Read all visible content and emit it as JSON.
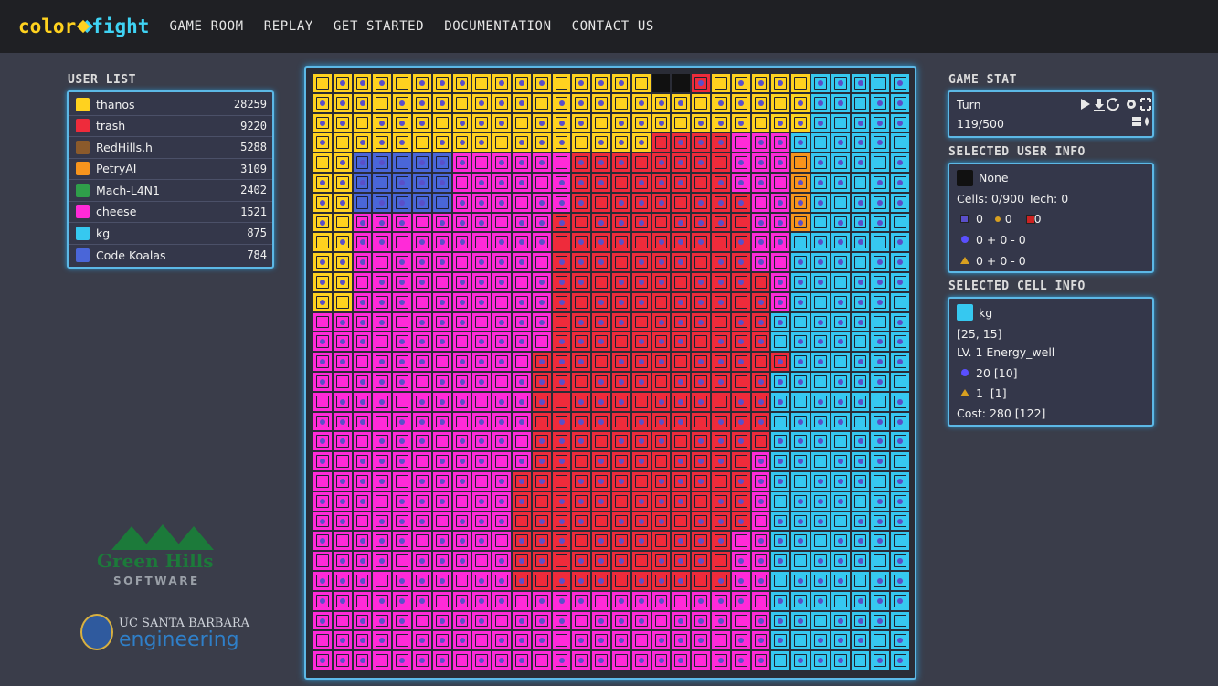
{
  "nav": {
    "logo_part1": "color",
    "logo_part2": "fight",
    "items": [
      "GAME ROOM",
      "REPLAY",
      "GET STARTED",
      "DOCUMENTATION",
      "CONTACT US"
    ]
  },
  "user_list": {
    "title": "USER LIST",
    "users": [
      {
        "name": "thanos",
        "score": "28259",
        "color": "#ffd21f"
      },
      {
        "name": "trash",
        "score": "9220",
        "color": "#ee2b3b"
      },
      {
        "name": "RedHills.h",
        "score": "5288",
        "color": "#8b5a2b"
      },
      {
        "name": "PetryAI",
        "score": "3109",
        "color": "#f7941d"
      },
      {
        "name": "Mach-L4N1",
        "score": "2402",
        "color": "#2f9e4a"
      },
      {
        "name": "cheese",
        "score": "1521",
        "color": "#ff2ad8"
      },
      {
        "name": "kg",
        "score": "875",
        "color": "#36c8f0"
      },
      {
        "name": "Code Koalas",
        "score": "784",
        "color": "#4a66d8"
      }
    ]
  },
  "game_stat": {
    "title": "GAME STAT",
    "turn_label": "Turn",
    "turn_value": "119/500"
  },
  "selected_user": {
    "title": "SELECTED USER INFO",
    "name": "None",
    "cells_tech": "Cells: 0/900  Tech: 0",
    "counts_line": "0      0      0",
    "energy_line": "0 + 0 - 0",
    "gold_line": "0 + 0 - 0"
  },
  "selected_cell": {
    "title": "SELECTED CELL INFO",
    "owner": "kg",
    "position": "[25, 15]",
    "building": "LV. 1 Energy_well",
    "energy": "20 [10]",
    "gold": "1  [1]",
    "cost": "Cost: 280 [122]"
  },
  "sponsors": {
    "ghs_name": "Green Hills",
    "ghs_sub": "SOFTWARE",
    "ucsb_top": "UC SANTA BARBARA",
    "ucsb_bottom": "engineering"
  }
}
